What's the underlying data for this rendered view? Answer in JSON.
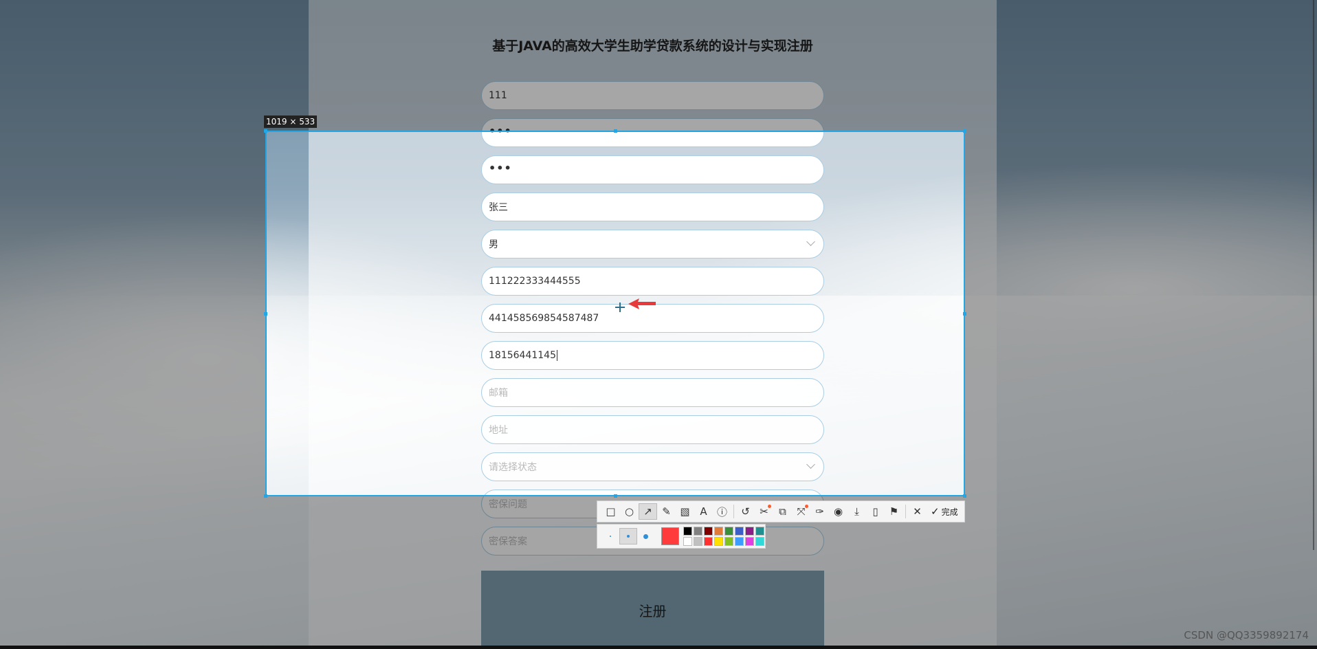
{
  "page": {
    "title": "基于JAVA的高效大学生助学贷款系统的设计与实现注册"
  },
  "form": {
    "fields": [
      {
        "name": "username",
        "value": "111",
        "placeholder": ""
      },
      {
        "name": "password",
        "value": "•••",
        "placeholder": ""
      },
      {
        "name": "confirm-password",
        "value": "•••",
        "placeholder": ""
      },
      {
        "name": "real-name",
        "value": "张三",
        "placeholder": ""
      },
      {
        "name": "gender",
        "value": "男",
        "placeholder": ""
      },
      {
        "name": "student-id",
        "value": "111222333444555",
        "placeholder": ""
      },
      {
        "name": "id-card",
        "value": "441458569854587487",
        "placeholder": ""
      },
      {
        "name": "phone",
        "value": "18156441145",
        "placeholder": ""
      },
      {
        "name": "email",
        "value": "",
        "placeholder": "邮箱"
      },
      {
        "name": "address",
        "value": "",
        "placeholder": "地址"
      },
      {
        "name": "status",
        "value": "",
        "placeholder": "请选择状态"
      },
      {
        "name": "security-question",
        "value": "",
        "placeholder": "密保问题"
      },
      {
        "name": "security-answer",
        "value": "",
        "placeholder": "密保答案"
      }
    ],
    "submit_label": "注册"
  },
  "screenshot_tool": {
    "size_label": "1019 × 533",
    "done_label": "完成",
    "tools": [
      "rectangle-icon",
      "ellipse-icon",
      "arrow-icon",
      "pencil-icon",
      "mosaic-icon",
      "text-icon",
      "number-icon",
      "undo-icon",
      "redo-icon",
      "ocr-icon",
      "scroll-capture-icon",
      "pin-icon",
      "record-icon",
      "save-icon",
      "copy-icon",
      "bookmark-icon",
      "close-icon"
    ],
    "current_color": "#ff3b3b",
    "swatches": [
      "#000000",
      "#808080",
      "#800000",
      "#e07b39",
      "#3a8f3a",
      "#3c5ec9",
      "#8a1f8a",
      "#1f8f8f",
      "#ffffff",
      "#c0c0c0",
      "#ff3030",
      "#ffe000",
      "#80c020",
      "#3c9cff",
      "#e040e0",
      "#30d8d8"
    ]
  },
  "watermark": "CSDN @QQ3359892174"
}
